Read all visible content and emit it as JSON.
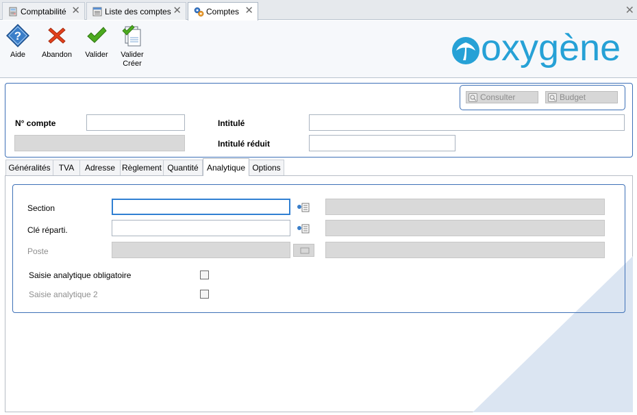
{
  "tabs": [
    {
      "label": "Comptabilité",
      "icon": "calculator-icon",
      "active": false
    },
    {
      "label": "Liste des comptes",
      "icon": "list-icon",
      "active": false
    },
    {
      "label": "Comptes",
      "icon": "gears-icon",
      "active": true
    }
  ],
  "toolbar": {
    "aide": "Aide",
    "abandon": "Abandon",
    "valider": "Valider",
    "valider_creer_1": "Valider",
    "valider_creer_2": "Créer"
  },
  "logo": "oxygène",
  "header": {
    "consulter": "Consulter",
    "budget": "Budget",
    "num_compte_label": "N° compte",
    "num_compte_value": "",
    "intitule_label": "Intitulé",
    "intitule_value": "",
    "intitule_reduit_label": "Intitulé réduit",
    "intitule_reduit_value": ""
  },
  "sub_tabs": [
    {
      "label": "Généralités",
      "active": false
    },
    {
      "label": "TVA",
      "active": false
    },
    {
      "label": "Adresse",
      "active": false
    },
    {
      "label": "Règlement",
      "active": false
    },
    {
      "label": "Quantité",
      "active": false
    },
    {
      "label": "Analytique",
      "active": true
    },
    {
      "label": "Options",
      "active": false
    }
  ],
  "analytique": {
    "section_label": "Section",
    "section_value": "",
    "cle_label": "Clé réparti.",
    "cle_value": "",
    "poste_label": "Poste",
    "poste_value": "",
    "saisie_obligatoire_label": "Saisie analytique obligatoire",
    "saisie_obligatoire_checked": false,
    "saisie2_label": "Saisie analytique 2",
    "saisie2_checked": false
  },
  "colors": {
    "accent": "#3c6fb6",
    "logo": "#26a1d6",
    "abandon": "#e2401c",
    "valider": "#4caa1f"
  }
}
